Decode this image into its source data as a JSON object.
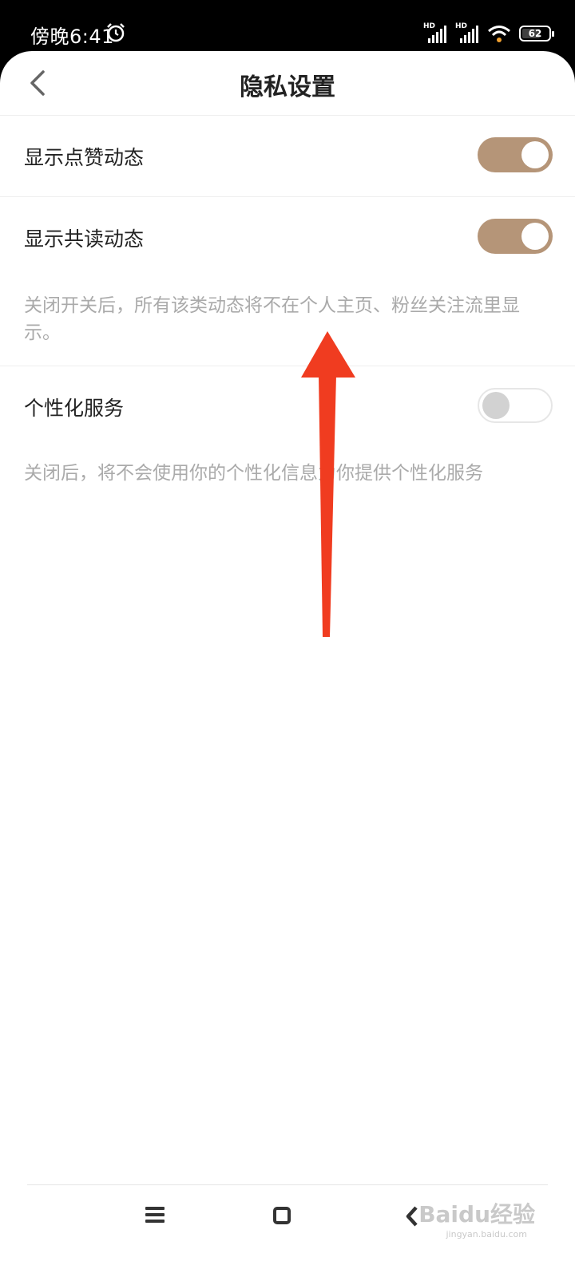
{
  "status_bar": {
    "time": "傍晚6:41",
    "signal1_label": "HD",
    "signal2_label": "HD",
    "battery": "62"
  },
  "header": {
    "title": "隐私设置"
  },
  "settings": [
    {
      "label": "显示点赞动态",
      "enabled": true
    },
    {
      "label": "显示共读动态",
      "enabled": true
    },
    {
      "label": "个性化服务",
      "enabled": false
    }
  ],
  "descriptions": {
    "activity_note": "关闭开关后，所有该类动态将不在个人主页、粉丝关注流里显示。",
    "personalization_note": "关闭后，将不会使用你的个性化信息为你提供个性化服务"
  },
  "watermark": {
    "brand": "Baidu经验",
    "url": "jingyan.baidu.com"
  },
  "colors": {
    "toggle_on": "#b59578",
    "arrow": "#f03c20"
  }
}
